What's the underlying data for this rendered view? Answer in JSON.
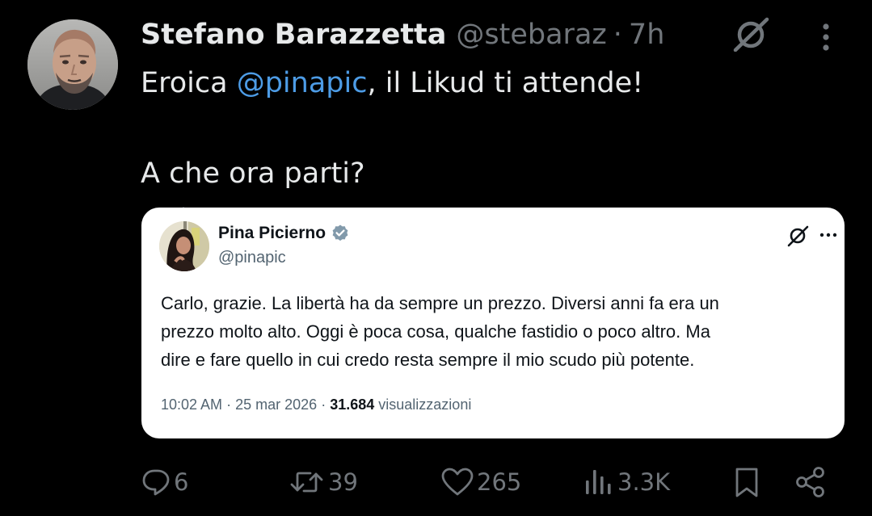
{
  "tweet": {
    "author_name": "Stefano Barazzetta",
    "handle": "@stebaraz",
    "separator": "·",
    "time_ago": "7h",
    "text_prefix": "Eroica ",
    "mention": "@pinapic",
    "text_suffix": ", il Likud ti attende!",
    "text_line2": "A che ora parti?"
  },
  "quote": {
    "author_name": "Pina Picierno",
    "handle": "@pinapic",
    "text_lines": [
      "Carlo, grazie. La libertà ha da sempre un prezzo. Diversi anni fa era un",
      "prezzo molto alto. Oggi è poca cosa, qualche fastidio o poco altro. Ma",
      "dire e fare quello in cui credo resta sempre il mio scudo più potente."
    ],
    "time": "10:02 AM",
    "date": "25 mar 2026",
    "separator": "·",
    "views_count": "31.684",
    "views_label": "visualizzazioni"
  },
  "actions": {
    "replies": "6",
    "reposts": "39",
    "likes": "265",
    "views": "3.3K"
  },
  "icons": {
    "grok": "grok-icon",
    "more": "more-dots-icon",
    "verified": "verified-badge-icon",
    "reply": "reply-bubble-icon",
    "repost": "repost-icon",
    "like": "heart-icon",
    "views": "analytics-bars-icon",
    "bookmark": "bookmark-icon",
    "share": "share-icon"
  },
  "colors": {
    "background": "#000000",
    "text_primary": "#e7e9ea",
    "text_secondary": "#71767b",
    "mention": "#4d9ce6",
    "quote_background": "#ffffff",
    "quote_text": "#0f1419",
    "quote_secondary": "#536471"
  }
}
